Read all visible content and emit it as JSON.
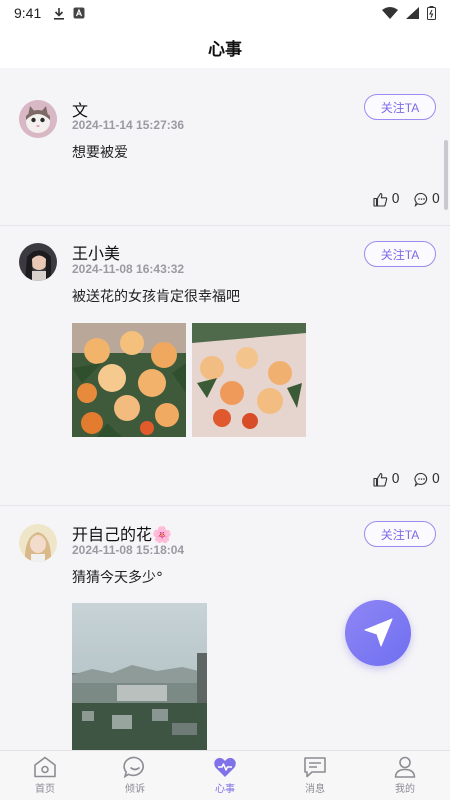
{
  "status_bar": {
    "time": "9:41"
  },
  "header": {
    "title": "心事"
  },
  "follow_label": "关注TA",
  "posts": [
    {
      "author": "文",
      "timestamp": "2024-11-14 15:27:36",
      "content": "想要被爱",
      "likes": "0",
      "comments": "0"
    },
    {
      "author": "王小美",
      "timestamp": "2024-11-08 16:43:32",
      "content": "被送花的女孩肯定很幸福吧",
      "likes": "0",
      "comments": "0"
    },
    {
      "author": "开自己的花🌸",
      "timestamp": "2024-11-08 15:18:04",
      "content": "猜猜今天多少°"
    }
  ],
  "tabs": [
    {
      "label": "首页",
      "icon": "home-icon"
    },
    {
      "label": "倾诉",
      "icon": "chat-bubble-icon"
    },
    {
      "label": "心事",
      "icon": "heart-icon"
    },
    {
      "label": "消息",
      "icon": "message-icon"
    },
    {
      "label": "我的",
      "icon": "profile-icon"
    }
  ],
  "colors": {
    "accent": "#8072e8",
    "follow_border": "#9b8cf0",
    "fab_gradient_start": "#8f86f5",
    "fab_gradient_end": "#6f6ff0"
  }
}
